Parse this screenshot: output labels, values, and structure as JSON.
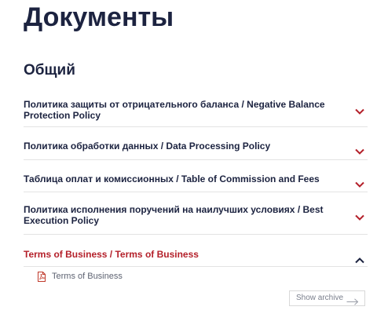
{
  "page": {
    "title": "Документы"
  },
  "section": {
    "title": "Общий"
  },
  "accordion": {
    "items": [
      {
        "label": "Политика защиты от отрицательного баланса / Negative Balance Protection Policy",
        "expanded": false,
        "icon": "chevron-down-icon"
      },
      {
        "label": "Политика обработки данных / Data Processing Policy",
        "expanded": false,
        "icon": "chevron-down-icon"
      },
      {
        "label": "Таблица оплат и комиссионных / Table of Commission and Fees",
        "expanded": false,
        "icon": "chevron-down-icon"
      },
      {
        "label": "Политика исполнения поручений на наилучших условиях / Best Execution Policy",
        "expanded": false,
        "icon": "chevron-down-icon"
      },
      {
        "label": "Terms of Business / Terms of Business",
        "expanded": true,
        "icon": "chevron-up-icon"
      }
    ],
    "open_item": {
      "documents": [
        {
          "label": "Terms of Business",
          "icon": "pdf-file-icon"
        }
      ]
    }
  },
  "archive": {
    "label": "Show archive",
    "icon": "arrow-right-icon"
  },
  "colors": {
    "heading": "#1c2340",
    "accent": "#b4202a",
    "muted_text": "#5e6372",
    "divider": "#e3e3e3"
  }
}
